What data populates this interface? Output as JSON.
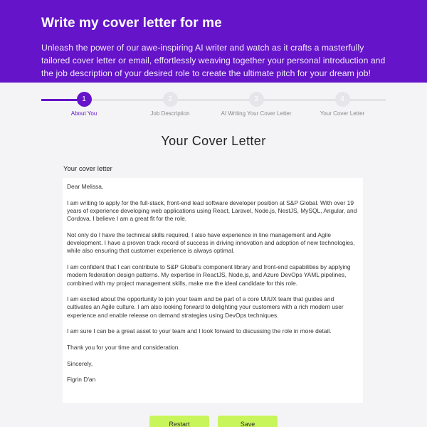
{
  "hero": {
    "title": "Write my cover letter for me",
    "subtitle": "Unleash the power of our awe-inspiring AI writer and watch as it crafts a masterfully tailored cover letter or email, effortlessly weaving together your personal introduction and the job description of your desired role to create the ultimate pitch for your dream job!"
  },
  "stepper": {
    "steps": [
      {
        "number": "1",
        "label": "About You",
        "active": true
      },
      {
        "number": "2",
        "label": "Job Description",
        "active": false
      },
      {
        "number": "3",
        "label": "AI Writing Your Cover Letter",
        "active": false
      },
      {
        "number": "4",
        "label": "Your Cover Letter",
        "active": false
      }
    ]
  },
  "main": {
    "section_title": "Your Cover Letter",
    "field_label": "Your cover letter",
    "letter": [
      "Dear Melissa,",
      "I am writing to apply for the full-stack, front-end lead software developer position at S&P Global. With over 19 years of experience developing web applications using React, Laravel, Node.js, NestJS, MySQL, Angular, and Cordova, I believe I am a great fit for the role.",
      "Not only do I have the technical skills required, I also have experience in line management and Agile development. I have a proven track record of success in driving innovation and adoption of new technologies, while also ensuring that customer experience is always optimal.",
      "I am confident that I can contribute to S&P Global's component library and front-end capabilities by applying modern federation design patterns. My expertise in ReactJS, Node.js, and Azure DevOps YAML pipelines, combined with my project management skills, make me the ideal candidate for this role.",
      "I am excited about the opportunity to join your team and be part of a core UI/UX team that guides and cultivates an Agile culture. I am also looking forward to delighting your customers with a rich modern user experience and enable release on demand strategies using DevOps techniques.",
      "I am sure I can be a great asset to your team and I look forward to discussing the role in more detail.",
      "Thank you for your time and consideration.",
      "Sincerely,",
      "Figrin D'an"
    ]
  },
  "actions": {
    "restart_label": "Restart",
    "save_label": "Save"
  },
  "colors": {
    "accent": "#6514c9",
    "button": "#c8f559",
    "inactive_step": "#e6e6ea"
  }
}
